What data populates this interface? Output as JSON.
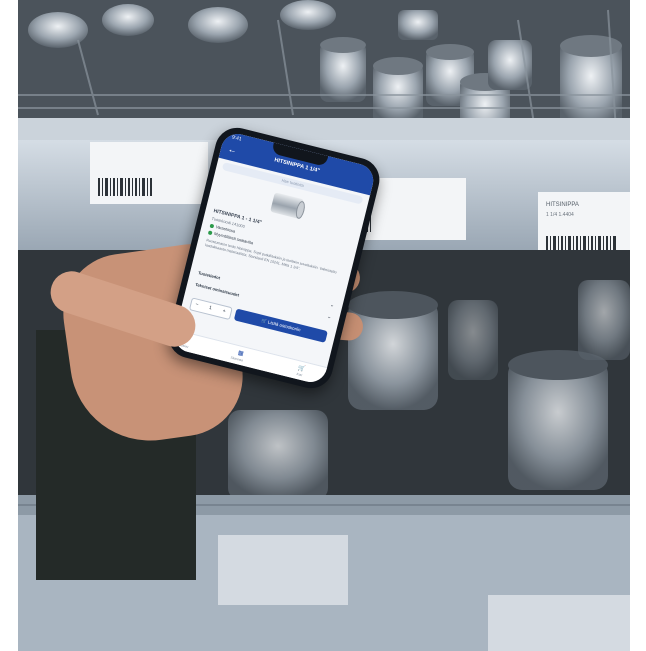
{
  "phone_app": {
    "status_time": "9:41",
    "header_title": "HITSINIPPA 1 1/4\"",
    "search_placeholder": "Hae tuotteita",
    "product_name": "HITSINIPPA 1 - 1 1/4\"",
    "product_code": "Tuotekoodi 141000",
    "stock_in": "Varastossa",
    "stock_store": "Myymälässä saatavilla",
    "description": "Ruostumaton teräs hitsinippa. Sopii putkiliitoksiin ja teollisiin sovelluksiin. Valmistettu laadukkaasta materiaalista. Standardi EN 10241. Mitta 1 1/4\".",
    "row1": "Tuotetiedot",
    "row2": "Tekniset ominaisuudet",
    "qty_minus": "−",
    "qty_value": "1",
    "qty_plus": "+",
    "add_button": "Lisää ostoskoriin",
    "tab_home": "Etusivu",
    "tab_scan": "Skannaa",
    "tab_cart": "Kori"
  },
  "shelf_labels": [
    {
      "text": "HITSINIPPA",
      "sub": "1 1/4 1.4404"
    }
  ],
  "colors": {
    "app_blue": "#1f4aa8",
    "shelf": "#b8c4d0"
  }
}
